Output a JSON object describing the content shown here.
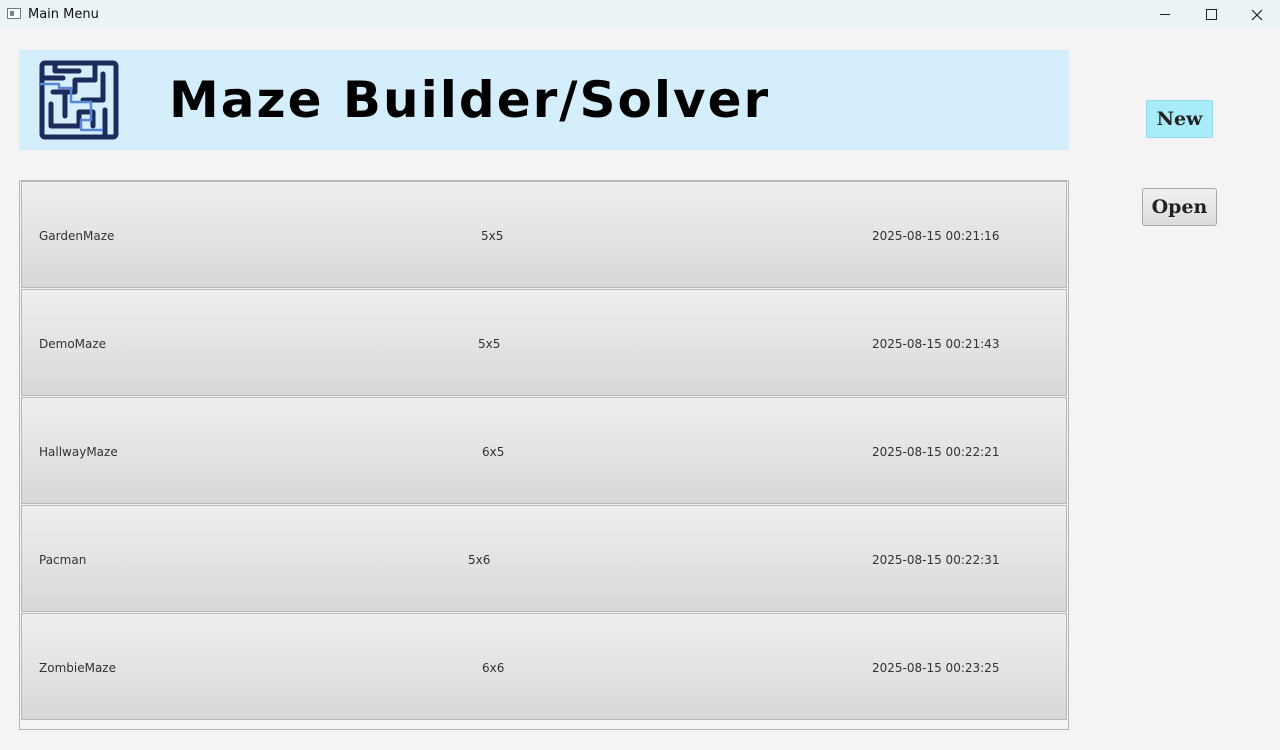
{
  "window": {
    "title": "Main Menu",
    "controls": {
      "minimize": "minimize-icon",
      "maximize": "maximize-icon",
      "close": "close-icon"
    }
  },
  "header": {
    "logo_icon": "maze-icon",
    "title": "Maze Builder/Solver",
    "banner_color": "#d4eefc"
  },
  "mazes": [
    {
      "name": "GardenMaze",
      "size": "5x5",
      "date": "2025-08-15 00:21:16"
    },
    {
      "name": "DemoMaze",
      "size": "5x5",
      "date": "2025-08-15 00:21:43"
    },
    {
      "name": "HallwayMaze",
      "size": "6x5",
      "date": "2025-08-15 00:22:21"
    },
    {
      "name": "Pacman",
      "size": "5x6",
      "date": "2025-08-15 00:22:31"
    },
    {
      "name": "ZombieMaze",
      "size": "6x6",
      "date": "2025-08-15 00:23:25"
    }
  ],
  "actions": {
    "new_label": "New",
    "open_label": "Open",
    "new_color": "#a8ecfa"
  }
}
